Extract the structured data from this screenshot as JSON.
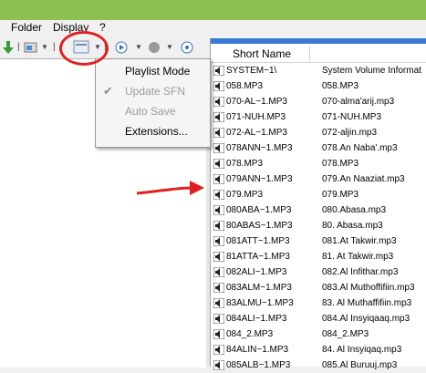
{
  "menu": {
    "folder": "Folder",
    "display": "Display",
    "help": "?"
  },
  "dropdown": {
    "items": [
      {
        "label": "Playlist Mode",
        "disabled": false,
        "checked": false
      },
      {
        "label": "Update SFN",
        "disabled": true,
        "checked": true
      },
      {
        "label": "Auto Save",
        "disabled": true,
        "checked": false
      },
      {
        "label": "Extensions...",
        "disabled": false,
        "checked": false
      }
    ]
  },
  "list": {
    "header": "Short Name",
    "rows": [
      {
        "short": "SYSTEM~1\\",
        "long": "System Volume Informat"
      },
      {
        "short": "058.MP3",
        "long": "058.MP3"
      },
      {
        "short": "070-AL~1.MP3",
        "long": "070-alma'arij.mp3"
      },
      {
        "short": "071-NUH.MP3",
        "long": "071-NUH.MP3"
      },
      {
        "short": "072-AL~1.MP3",
        "long": "072-aljin.mp3"
      },
      {
        "short": "078ANN~1.MP3",
        "long": "078.An Naba'.mp3"
      },
      {
        "short": "078.MP3",
        "long": "078.MP3"
      },
      {
        "short": "079ANN~1.MP3",
        "long": "079.An Naaziat.mp3"
      },
      {
        "short": "079.MP3",
        "long": "079.MP3"
      },
      {
        "short": "080ABA~1.MP3",
        "long": "080.Abasa.mp3"
      },
      {
        "short": "80ABAS~1.MP3",
        "long": "80. Abasa.mp3"
      },
      {
        "short": "081ATT~1.MP3",
        "long": "081.At Takwir.mp3"
      },
      {
        "short": "81ATTA~1.MP3",
        "long": "81. At Takwir.mp3"
      },
      {
        "short": "082ALI~1.MP3",
        "long": "082.Al Infithar.mp3"
      },
      {
        "short": "083ALM~1.MP3",
        "long": "083.Al Muthoffifiin.mp3"
      },
      {
        "short": "83ALMU~1.MP3",
        "long": "83. Al Muthaffifiin.mp3"
      },
      {
        "short": "084ALI~1.MP3",
        "long": "084.Al Insyiqaaq.mp3"
      },
      {
        "short": "084_2.MP3",
        "long": "084_2.MP3"
      },
      {
        "short": "84ALIN~1.MP3",
        "long": "84. Al Insyiqaq.mp3"
      },
      {
        "short": "085ALB~1.MP3",
        "long": "085.Al Buruuj.mp3"
      }
    ]
  },
  "colors": {
    "titlebar": "#8ec050",
    "annotation": "#e02020",
    "selection_bar": "#3a7bd5"
  }
}
